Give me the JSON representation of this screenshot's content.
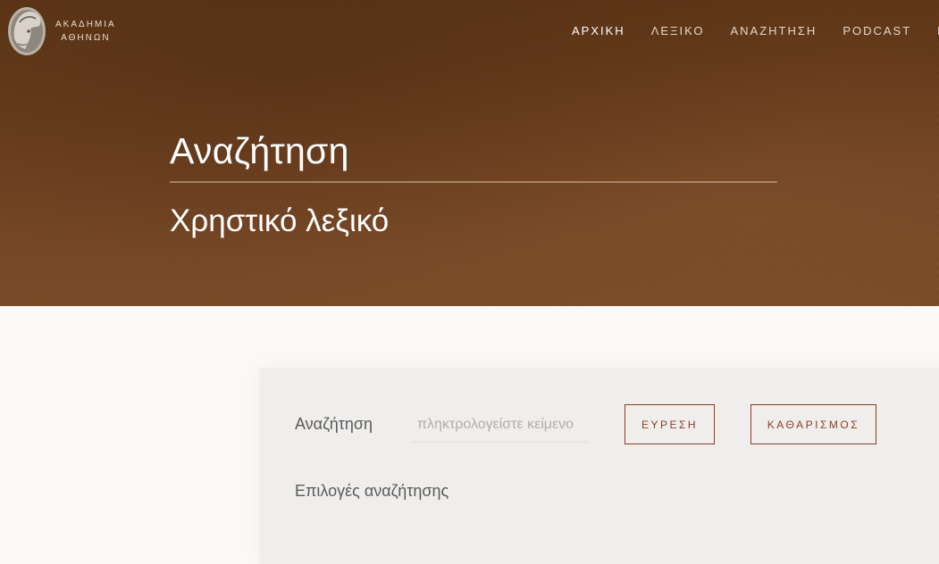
{
  "header": {
    "logo_lines": [
      "ΑΚΑΔΗΜΙΑ",
      "ΑΘΗΝΩΝ"
    ],
    "logo_icon": "athena-helmet-coin-icon",
    "nav": [
      {
        "label": "ΑΡΧΙΚΗ",
        "active": true
      },
      {
        "label": "ΛΕΞΙΚΟ",
        "active": false
      },
      {
        "label": "ΑΝΑΖΗΤΗΣΗ",
        "active": false
      },
      {
        "label": "PODCAST",
        "active": false
      },
      {
        "label": "ΕΠ",
        "active": false
      }
    ]
  },
  "hero": {
    "title": "Αναζήτηση",
    "subtitle": "Χρηστικό λεξικό"
  },
  "search": {
    "label": "Αναζήτηση",
    "placeholder": "πληκτρολογείστε κείμενο",
    "value": "",
    "find_label": "ΕΥΡΕΣΗ",
    "clear_label": "ΚΑΘΑΡΙΣΜΟΣ",
    "options_label": "Επιλογές αναζήτησης"
  },
  "colors": {
    "hero_brown": "#6a3e1d",
    "accent": "#8a3e1f",
    "panel": "#f0eeec"
  }
}
